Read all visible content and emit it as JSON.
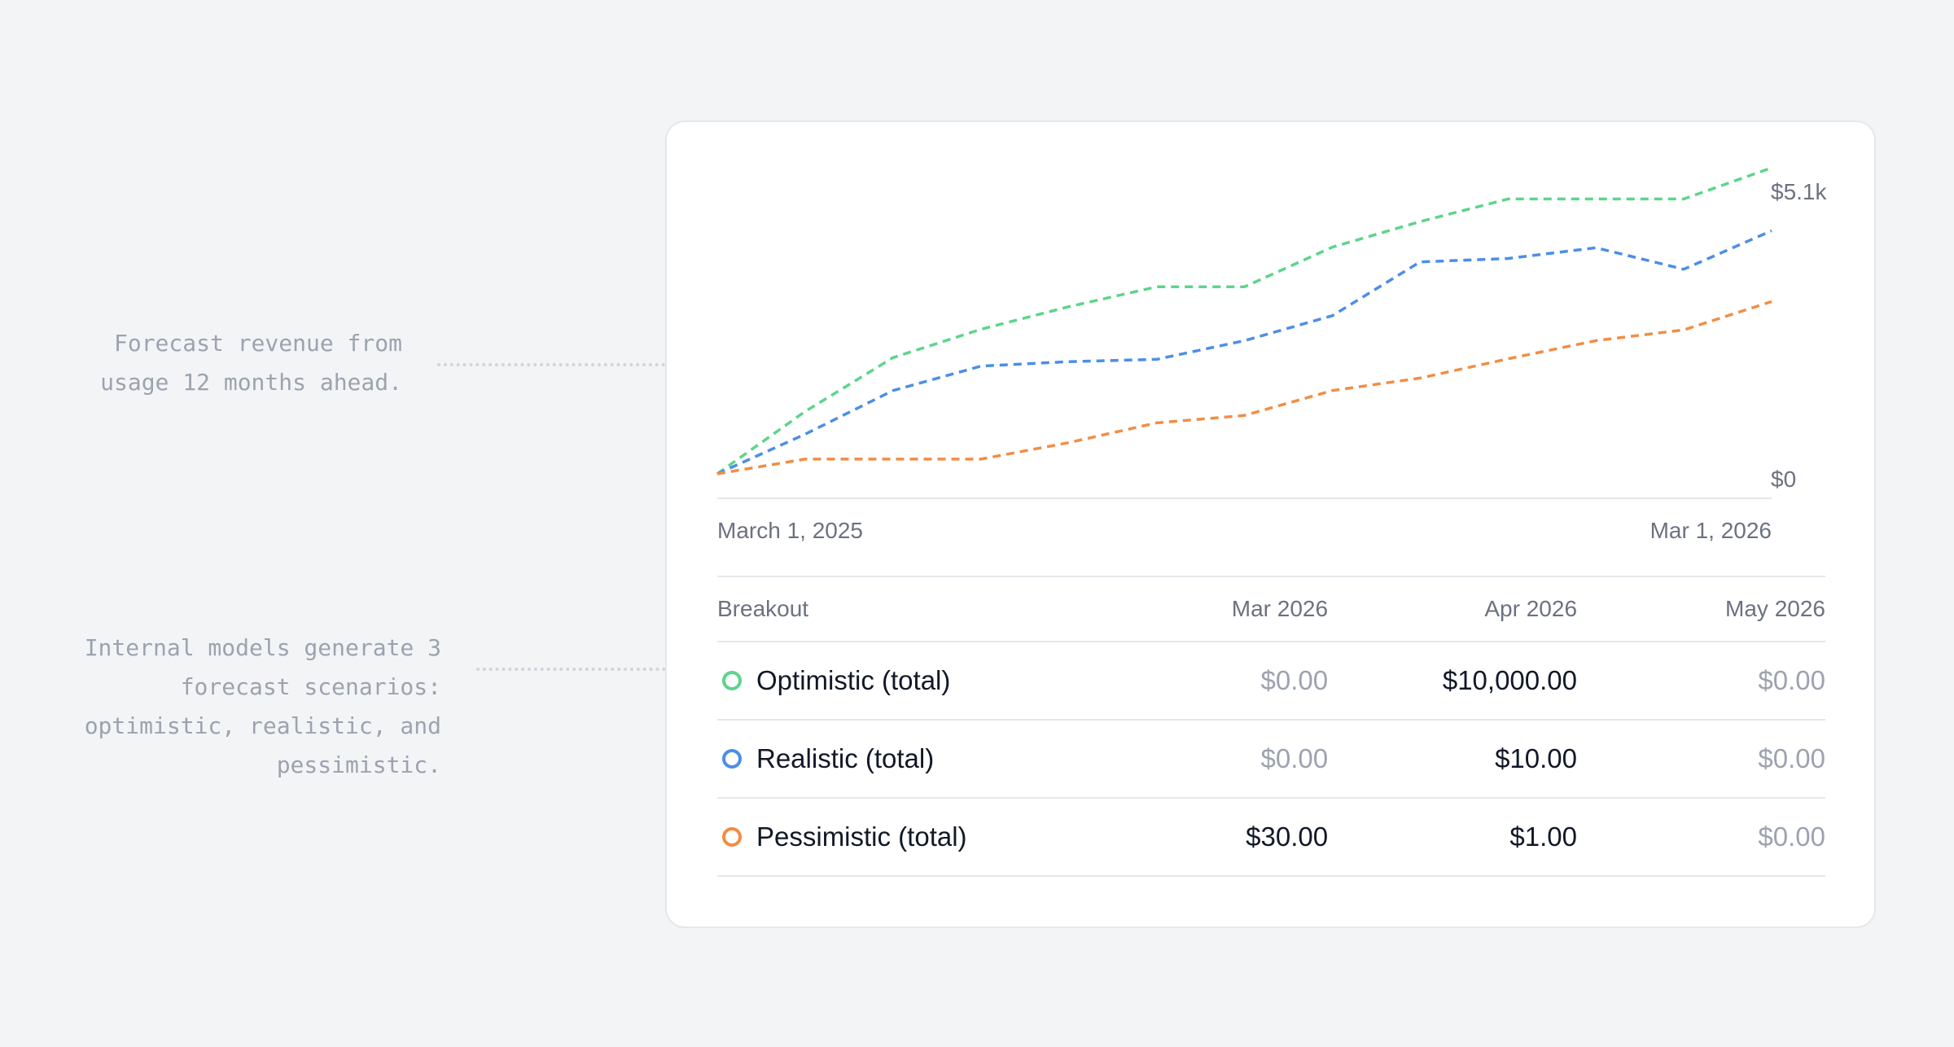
{
  "annotations": {
    "forecast_note": "Forecast revenue from\nusage 12 months ahead.",
    "models_note": "Internal models generate 3\nforecast scenarios:\noptimistic, realistic, and\npessimistic."
  },
  "colors": {
    "optimistic": "#5dd58a",
    "realistic": "#4c8ee8",
    "pessimistic": "#f28d45",
    "axis": "#e5e7eb"
  },
  "chart_data": {
    "type": "line",
    "line_style": "dashed",
    "x": [
      "Mar 2025",
      "Apr 2025",
      "May 2025",
      "Jun 2025",
      "Jul 2025",
      "Aug 2025",
      "Sep 2025",
      "Oct 2025",
      "Nov 2025",
      "Dec 2025",
      "Jan 2026",
      "Feb 2026",
      "Mar 2026"
    ],
    "x_tick_labels": [
      "March 1, 2025",
      "Mar 1, 2026"
    ],
    "y_tick_labels": [
      "$5.1k",
      "$0"
    ],
    "ylim": [
      0,
      5100
    ],
    "grid": false,
    "legend": "none",
    "series": [
      {
        "key": "optimistic",
        "values": [
          0,
          1100,
          2050,
          2550,
          2950,
          3300,
          3300,
          4000,
          4450,
          4850,
          4850,
          4850,
          5400
        ]
      },
      {
        "key": "realistic",
        "values": [
          0,
          700,
          1470,
          1900,
          1980,
          2020,
          2350,
          2790,
          3740,
          3800,
          3990,
          3610,
          4290
        ]
      },
      {
        "key": "pessimistic",
        "values": [
          0,
          260,
          260,
          260,
          550,
          900,
          1030,
          1470,
          1690,
          2030,
          2350,
          2540,
          3040
        ]
      }
    ]
  },
  "table": {
    "headers": [
      "Breakout",
      "Mar 2026",
      "Apr 2026",
      "May 2026"
    ],
    "rows": [
      {
        "key": "optimistic",
        "name": "Optimistic (total)",
        "values": [
          "$0.00",
          "$10,000.00",
          "$0.00"
        ],
        "muted": [
          true,
          false,
          true
        ]
      },
      {
        "key": "realistic",
        "name": "Realistic (total)",
        "values": [
          "$0.00",
          "$10.00",
          "$0.00"
        ],
        "muted": [
          true,
          false,
          true
        ]
      },
      {
        "key": "pessimistic",
        "name": "Pessimistic (total)",
        "values": [
          "$30.00",
          "$1.00",
          "$0.00"
        ],
        "muted": [
          false,
          false,
          true
        ]
      }
    ]
  }
}
